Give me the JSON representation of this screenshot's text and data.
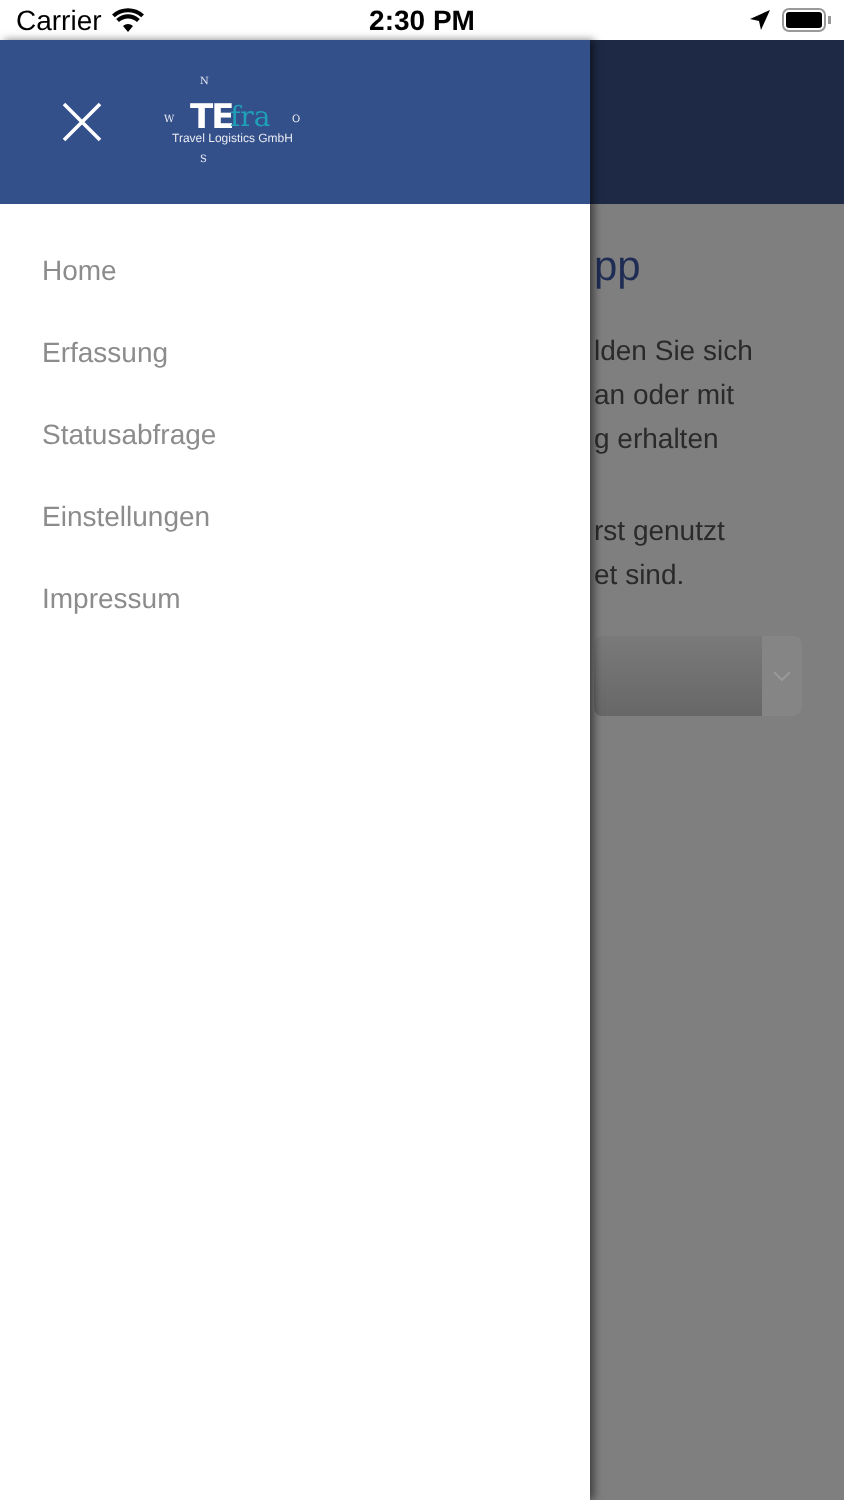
{
  "status_bar": {
    "carrier": "Carrier",
    "time": "2:30 PM"
  },
  "drawer": {
    "logo": {
      "main": "TE",
      "accent": "fra",
      "tagline": "Travel Logistics GmbH",
      "north": "N",
      "west": "W",
      "east": "O",
      "south": "S"
    },
    "items": [
      {
        "label": "Home"
      },
      {
        "label": "Erfassung"
      },
      {
        "label": "Statusabfrage"
      },
      {
        "label": "Einstellungen"
      },
      {
        "label": "Impressum"
      }
    ]
  },
  "background_page": {
    "title": "pp",
    "paragraphs": [
      [
        "lden Sie sich",
        "an oder mit",
        "g erhalten"
      ],
      [
        "rst genutzt",
        "et sind."
      ]
    ]
  }
}
